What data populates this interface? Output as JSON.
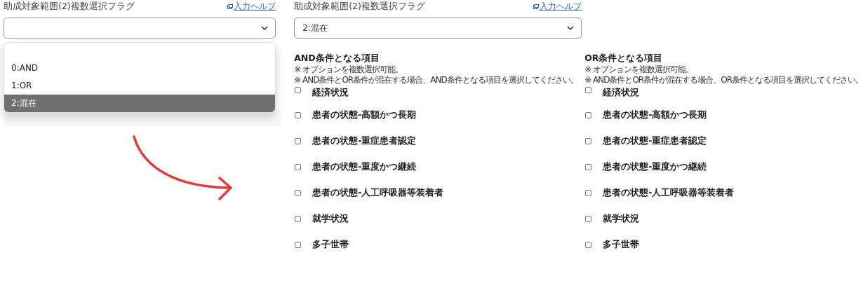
{
  "before": {
    "field_label": "助成対象範囲(2)複数選択フラグ",
    "help_link": "入力ヘルプ",
    "options": [
      {
        "label": "0:AND",
        "selected": false
      },
      {
        "label": "1:OR",
        "selected": false
      },
      {
        "label": "2:混在",
        "selected": true
      }
    ]
  },
  "after": {
    "field_label": "助成対象範囲(2)複数選択フラグ",
    "help_link": "入力ヘルプ",
    "value": "2:混在"
  },
  "groups": [
    {
      "title": "AND条件となる項目",
      "notes": [
        "※ オプションを複数選択可能。",
        "※ AND条件とOR条件が混在する場合、AND条件となる項目を選択してください。"
      ],
      "items": [
        {
          "label": "経済状況",
          "checked": false
        },
        {
          "label": "患者の状態-高額かつ長期",
          "checked": false
        },
        {
          "label": "患者の状態-重症患者認定",
          "checked": false
        },
        {
          "label": "患者の状態-重度かつ継続",
          "checked": false
        },
        {
          "label": "患者の状態-人工呼吸器等装着者",
          "checked": false
        },
        {
          "label": "就学状況",
          "checked": false
        },
        {
          "label": "多子世帯",
          "checked": false
        }
      ]
    },
    {
      "title": "OR条件となる項目",
      "notes": [
        "※ オプションを複数選択可能。",
        "※ AND条件とOR条件が混在する場合、OR条件となる項目を選択してください。"
      ],
      "items": [
        {
          "label": "経済状況",
          "checked": false
        },
        {
          "label": "患者の状態-高額かつ長期",
          "checked": false
        },
        {
          "label": "患者の状態-重症患者認定",
          "checked": false
        },
        {
          "label": "患者の状態-重度かつ継続",
          "checked": false
        },
        {
          "label": "患者の状態-人工呼吸器等装着者",
          "checked": false
        },
        {
          "label": "就学状況",
          "checked": false
        },
        {
          "label": "多子世帯",
          "checked": false
        }
      ]
    }
  ]
}
